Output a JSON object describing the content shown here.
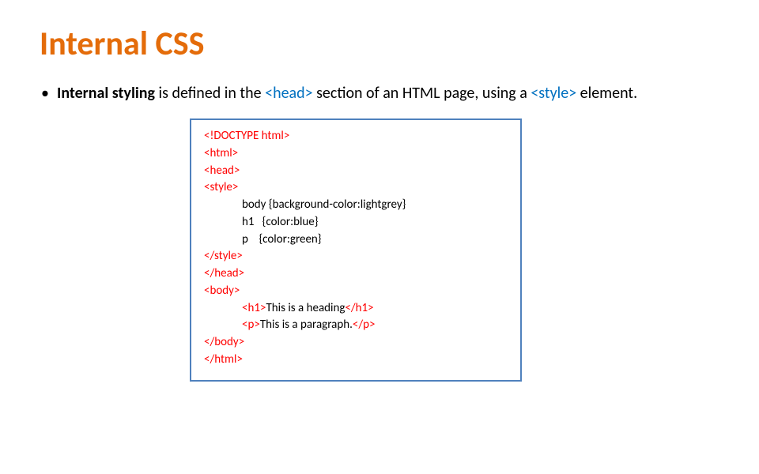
{
  "slide": {
    "title": "Internal CSS",
    "bullet": {
      "lead": "Internal styling",
      "text1": " is defined in the ",
      "headTag": "<head>",
      "text2": " section of an HTML page, using a ",
      "styleTag": "<style>",
      "text3": " element."
    }
  },
  "code": {
    "l1": "<!DOCTYPE html>",
    "l2": "<html>",
    "l3": "<head>",
    "l4": "<style>",
    "l5": "body {background-color:lightgrey}",
    "l6": "h1   {color:blue}",
    "l7": "p    {color:green}",
    "l8": "</style>",
    "l9": "</head>",
    "l10": "<body>",
    "l11a": "<h1>",
    "l11b": "This is a heading",
    "l11c": "</h1>",
    "l12a": "<p>",
    "l12b": "This is a paragraph.",
    "l12c": "</p>",
    "l13": "</body>",
    "l14": "</html>"
  }
}
